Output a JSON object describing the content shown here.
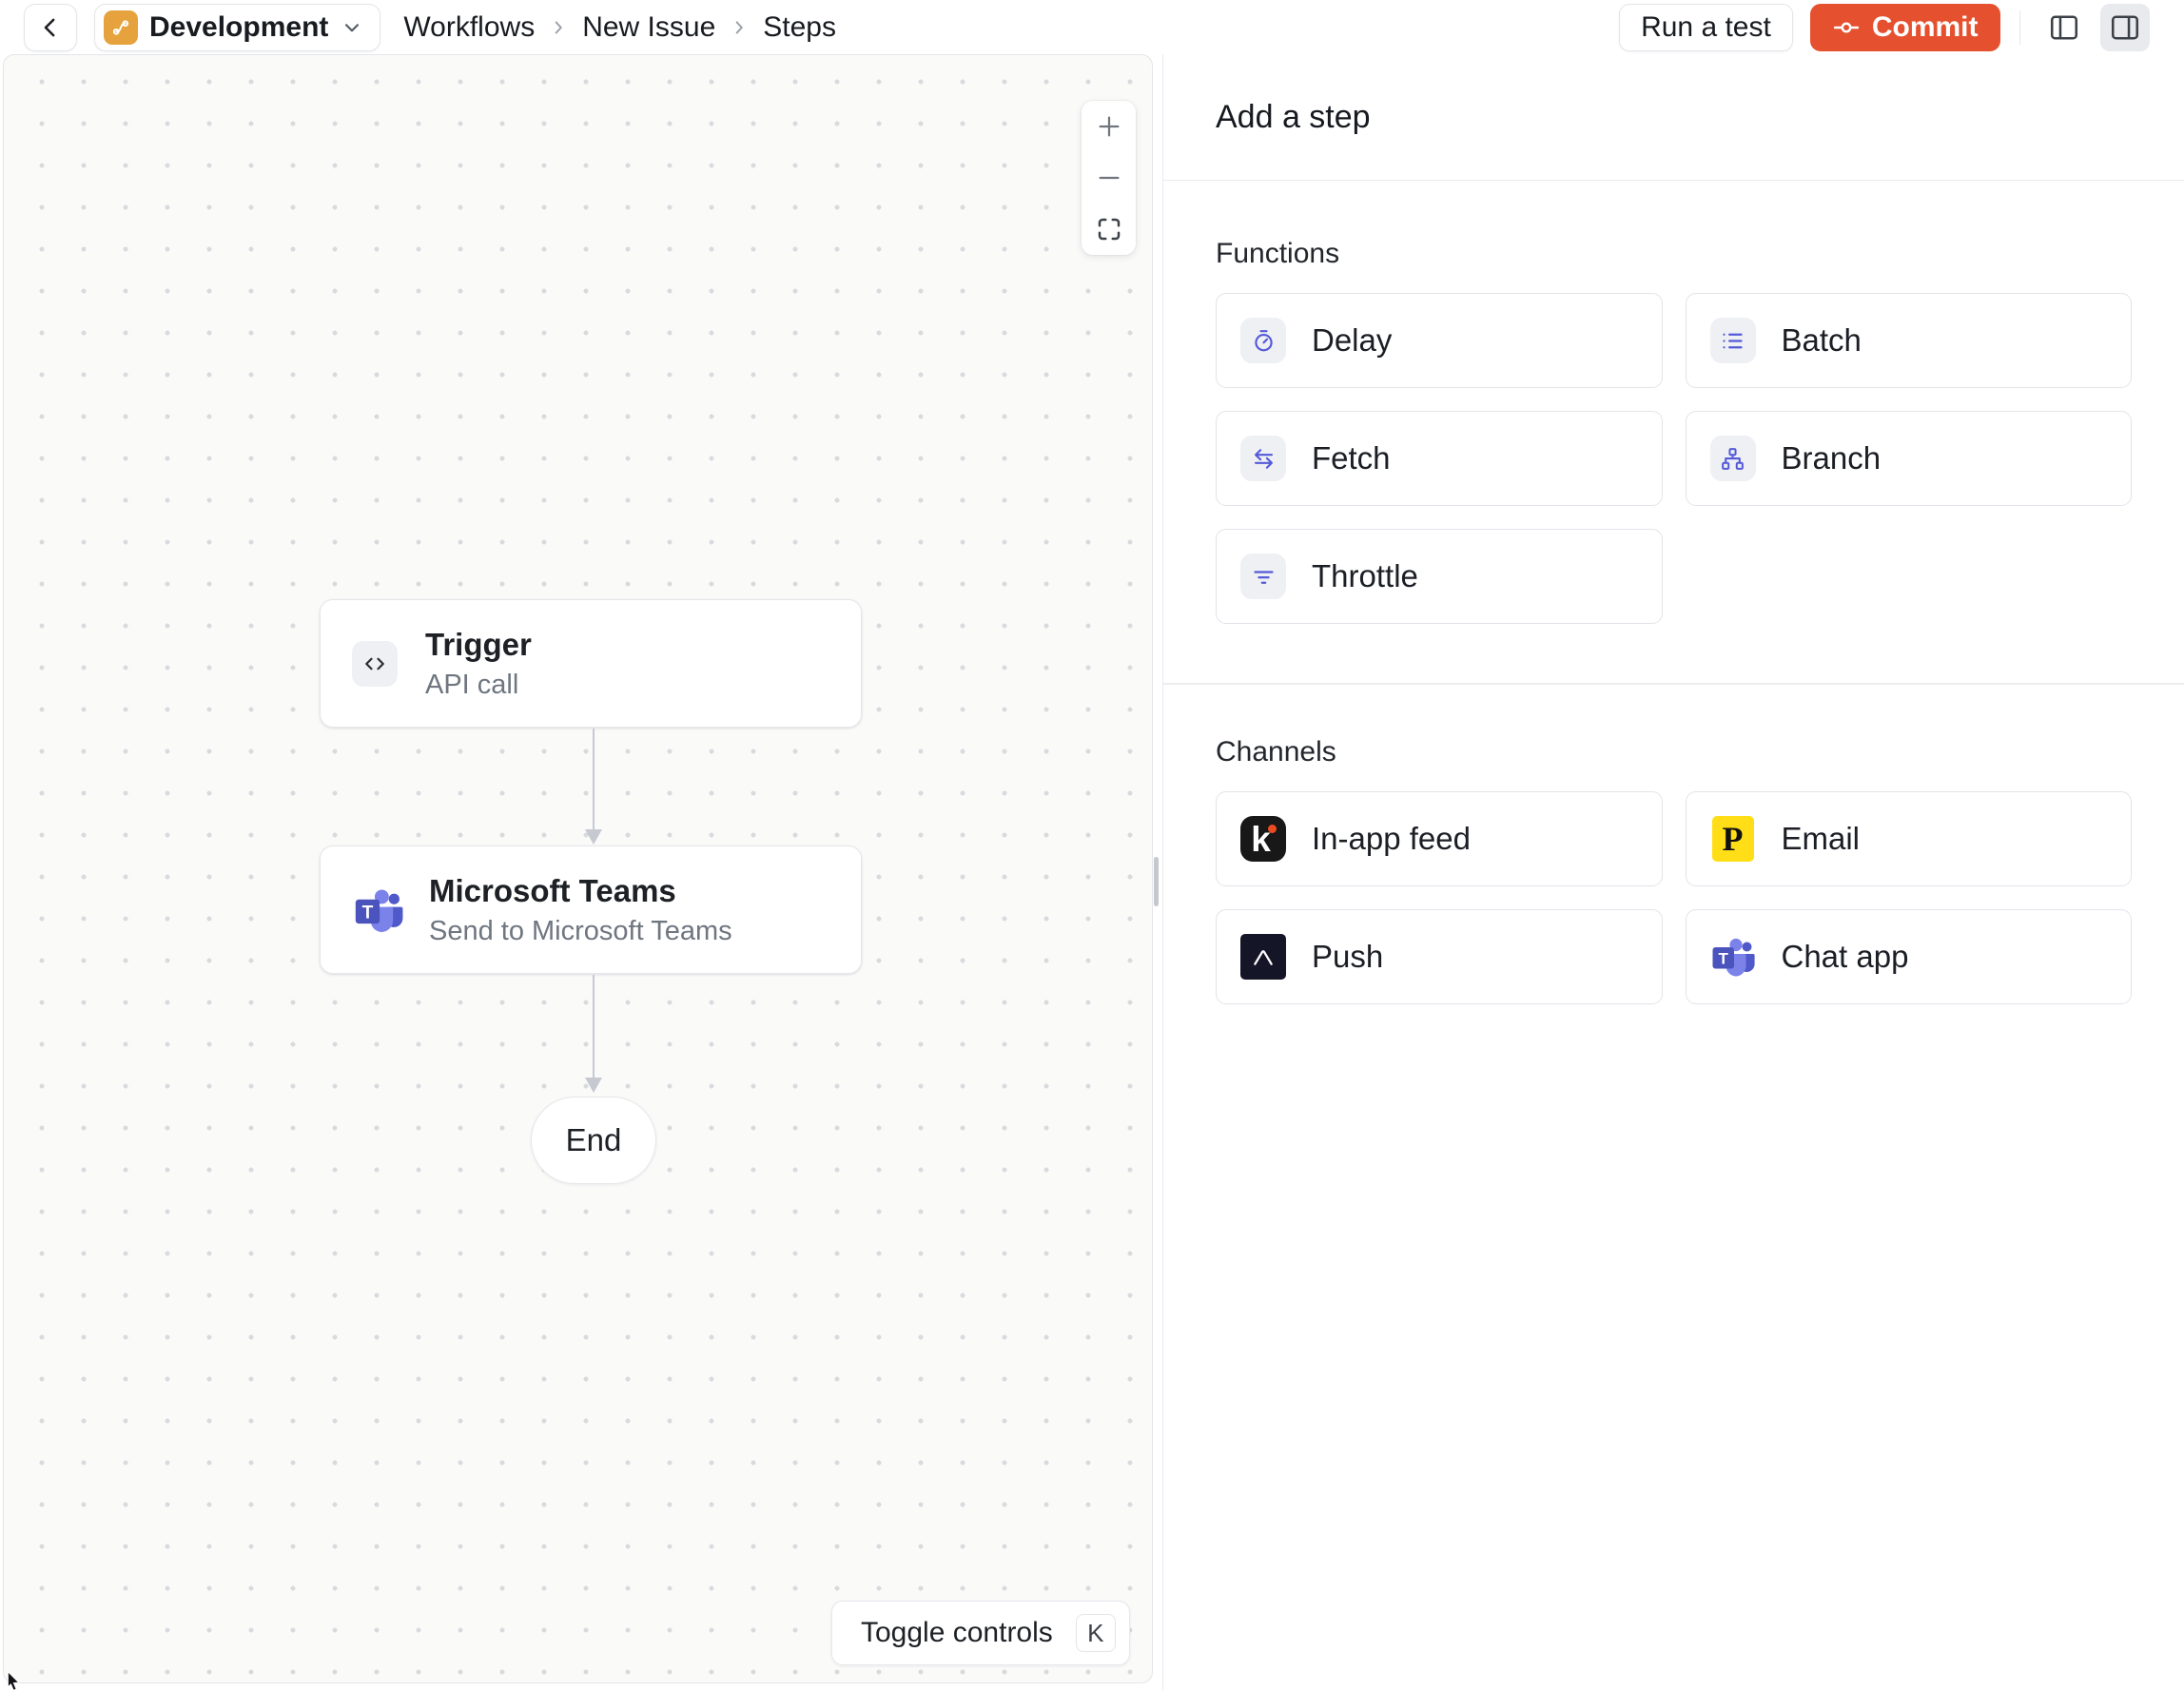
{
  "header": {
    "environment_label": "Development",
    "breadcrumb": [
      "Workflows",
      "New Issue",
      "Steps"
    ],
    "run_test_label": "Run a test",
    "commit_label": "Commit"
  },
  "canvas": {
    "zoom_in": "+",
    "zoom_out": "−",
    "nodes": {
      "trigger": {
        "title": "Trigger",
        "subtitle": "API call",
        "icon": "code-icon"
      },
      "teams": {
        "title": "Microsoft Teams",
        "subtitle": "Send to Microsoft Teams",
        "icon": "ms-teams-logo-icon"
      },
      "end": {
        "title": "End"
      }
    },
    "toggle_controls_label": "Toggle controls",
    "toggle_controls_shortcut": "K"
  },
  "panel": {
    "title": "Add a step",
    "sections": [
      {
        "label": "Functions",
        "items": [
          {
            "label": "Delay",
            "icon": "timer-icon"
          },
          {
            "label": "Batch",
            "icon": "list-icon"
          },
          {
            "label": "Fetch",
            "icon": "swap-arrows-icon"
          },
          {
            "label": "Branch",
            "icon": "hierarchy-icon"
          },
          {
            "label": "Throttle",
            "icon": "filter-lines-icon"
          }
        ]
      },
      {
        "label": "Channels",
        "items": [
          {
            "label": "In-app feed",
            "icon": "knock-logo-icon"
          },
          {
            "label": "Email",
            "icon": "postmark-logo-icon"
          },
          {
            "label": "Push",
            "icon": "expo-logo-icon"
          },
          {
            "label": "Chat app",
            "icon": "ms-teams-logo-icon"
          }
        ]
      }
    ]
  },
  "colors": {
    "commit_accent": "#e5512f",
    "environment_icon_bg": "#e6a23c",
    "function_icon_indigo": "#545ad8",
    "postmark_yellow": "#ffde17",
    "knock_black": "#181818",
    "expo_dark": "#141527",
    "teams_purple": "#4b53bc",
    "canvas_bg": "#fafaf9"
  }
}
